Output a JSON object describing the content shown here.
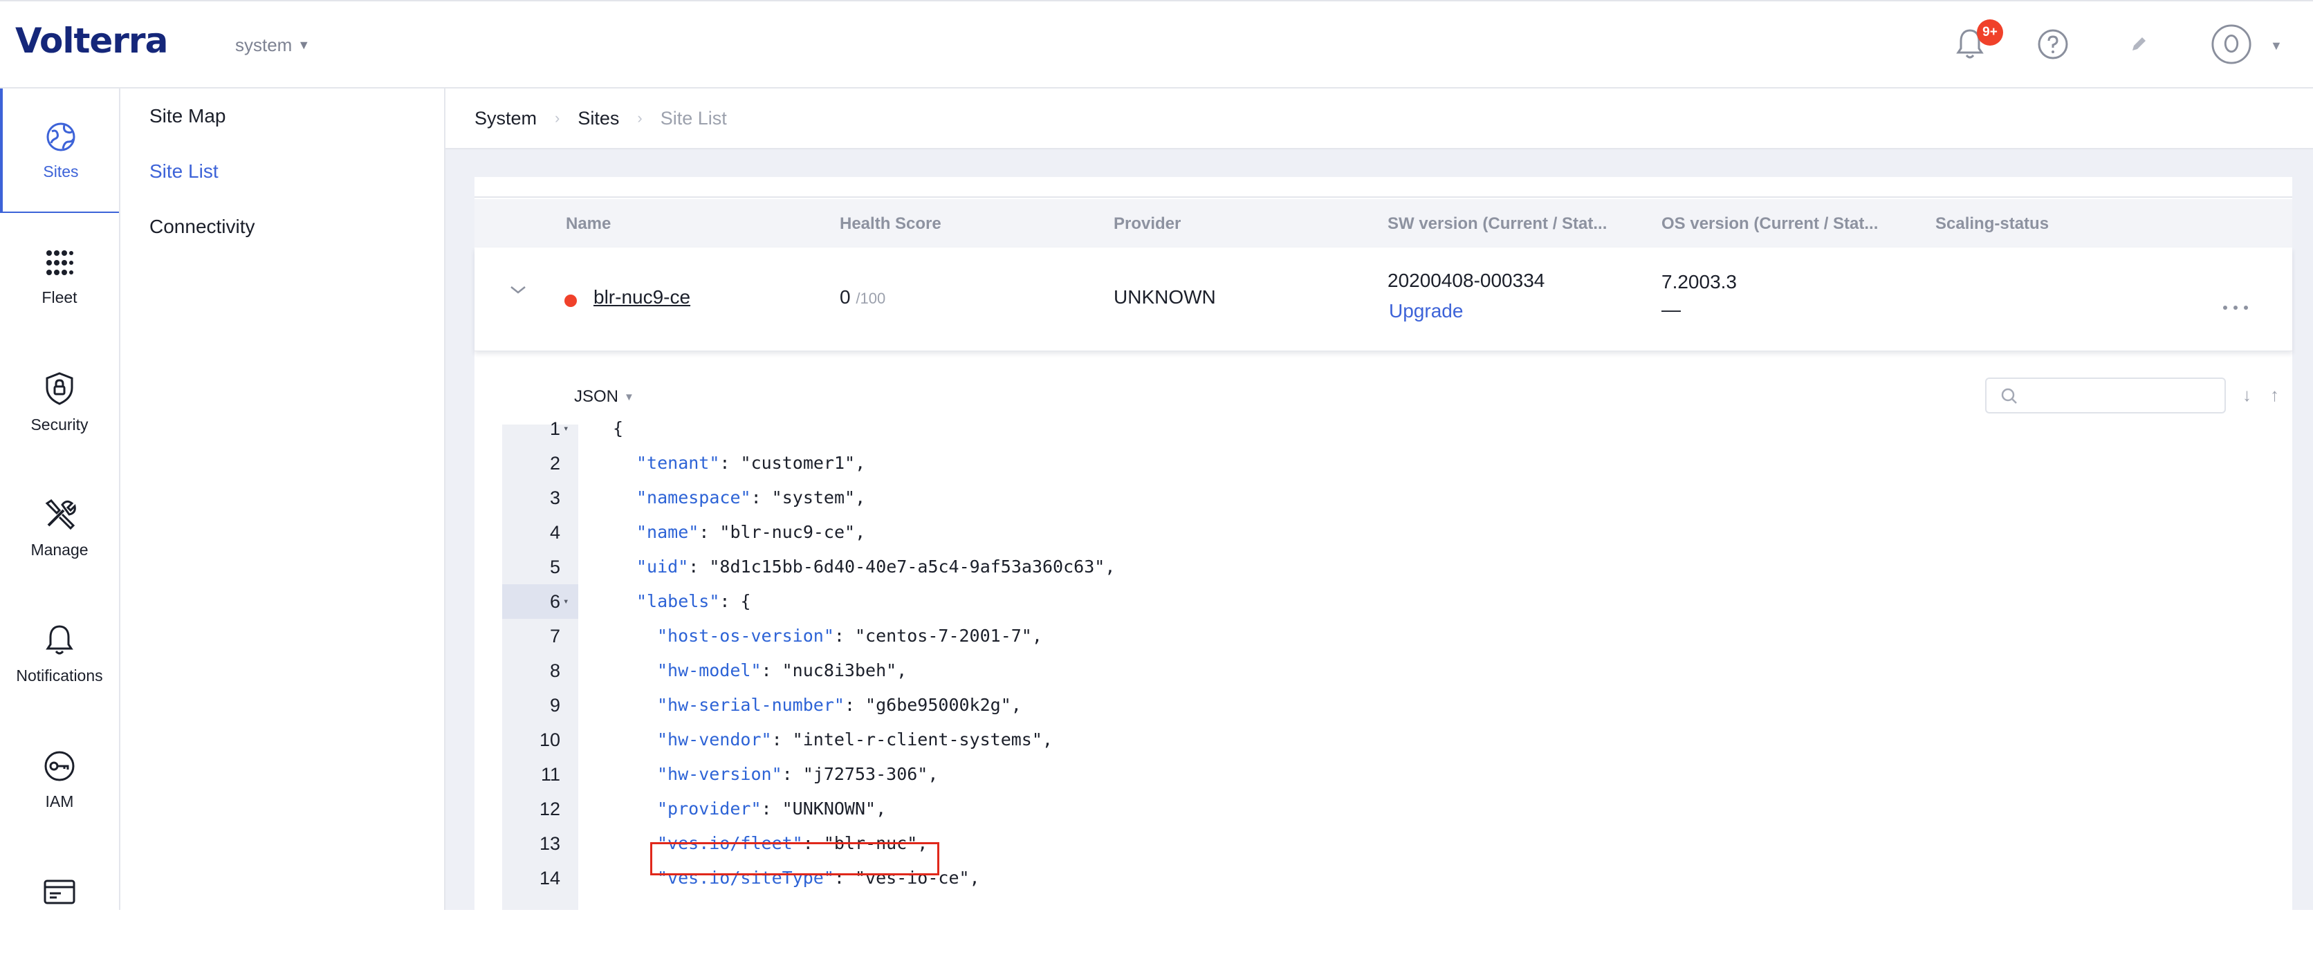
{
  "app": {
    "logo_text": "Volterra",
    "namespace_selector": "system",
    "notification_badge": "9+",
    "icons": {
      "notifications": "bell-icon",
      "help": "help-circle-icon",
      "edit": "pencil-icon",
      "user": "user-avatar-icon"
    }
  },
  "rail": {
    "items": [
      {
        "label": "Sites",
        "icon": "globe-icon",
        "active": true
      },
      {
        "label": "Fleet",
        "icon": "fleet-icon"
      },
      {
        "label": "Security",
        "icon": "shield-lock-icon"
      },
      {
        "label": "Manage",
        "icon": "tools-icon"
      },
      {
        "label": "Notifications",
        "icon": "bell-icon"
      },
      {
        "label": "IAM",
        "icon": "key-icon"
      },
      {
        "label": "",
        "icon": "billing-card-icon"
      }
    ]
  },
  "subnav": {
    "items": [
      {
        "label": "Site Map"
      },
      {
        "label": "Site List",
        "active": true
      },
      {
        "label": "Connectivity"
      }
    ]
  },
  "breadcrumb": [
    "System",
    "Sites",
    "Site List"
  ],
  "table": {
    "headers": [
      "Name",
      "Health Score",
      "Provider",
      "SW version (Current / Stat...",
      "OS version (Current / Stat...",
      "Scaling-status"
    ],
    "row": {
      "name": "blr-nuc9-ce",
      "health": "0",
      "health_max": "/100",
      "provider": "UNKNOWN",
      "sw_version": "20200408-000334",
      "sw_action": "Upgrade",
      "os_version": "7.2003.3",
      "os_status": "—",
      "menu": "..."
    }
  },
  "json_view": {
    "format": "JSON",
    "search_placeholder": "",
    "sort_down": "↓",
    "sort_up": "↑",
    "lines": [
      {
        "n": "1",
        "key": "",
        "text": "{",
        "indent": 0,
        "fold": true
      },
      {
        "n": "2",
        "key": "\"tenant\"",
        "text": ": \"customer1\",",
        "indent": 1
      },
      {
        "n": "3",
        "key": "\"namespace\"",
        "text": ": \"system\",",
        "indent": 1
      },
      {
        "n": "4",
        "key": "\"name\"",
        "text": ": \"blr-nuc9-ce\",",
        "indent": 1
      },
      {
        "n": "5",
        "key": "\"uid\"",
        "text": ": \"8d1c15bb-6d40-40e7-a5c4-9af53a360c63\",",
        "indent": 1
      },
      {
        "n": "6",
        "key": "\"labels\"",
        "text": ": {",
        "indent": 1,
        "fold": true,
        "active": true
      },
      {
        "n": "7",
        "key": "\"host-os-version\"",
        "text": ": \"centos-7-2001-7\",",
        "indent": 2
      },
      {
        "n": "8",
        "key": "\"hw-model\"",
        "text": ": \"nuc8i3beh\",",
        "indent": 2
      },
      {
        "n": "9",
        "key": "\"hw-serial-number\"",
        "text": ": \"g6be95000k2g\",",
        "indent": 2
      },
      {
        "n": "10",
        "key": "\"hw-vendor\"",
        "text": ": \"intel-r-client-systems\",",
        "indent": 2
      },
      {
        "n": "11",
        "key": "\"hw-version\"",
        "text": ": \"j72753-306\",",
        "indent": 2
      },
      {
        "n": "12",
        "key": "\"provider\"",
        "text": ": \"UNKNOWN\",",
        "indent": 2
      },
      {
        "n": "13",
        "key": "\"ves.io/fleet\"",
        "text": ": \"blr-nuc\",",
        "indent": 2,
        "highlighted": true
      },
      {
        "n": "14",
        "key": "\"ves.io/siteType\"",
        "text": ": \"ves-io-ce\",",
        "indent": 2
      }
    ]
  },
  "colors": {
    "brand": "#15277a",
    "accent": "#3d63d8",
    "status_red": "#f0412a",
    "highlight_box": "#e0281b"
  }
}
